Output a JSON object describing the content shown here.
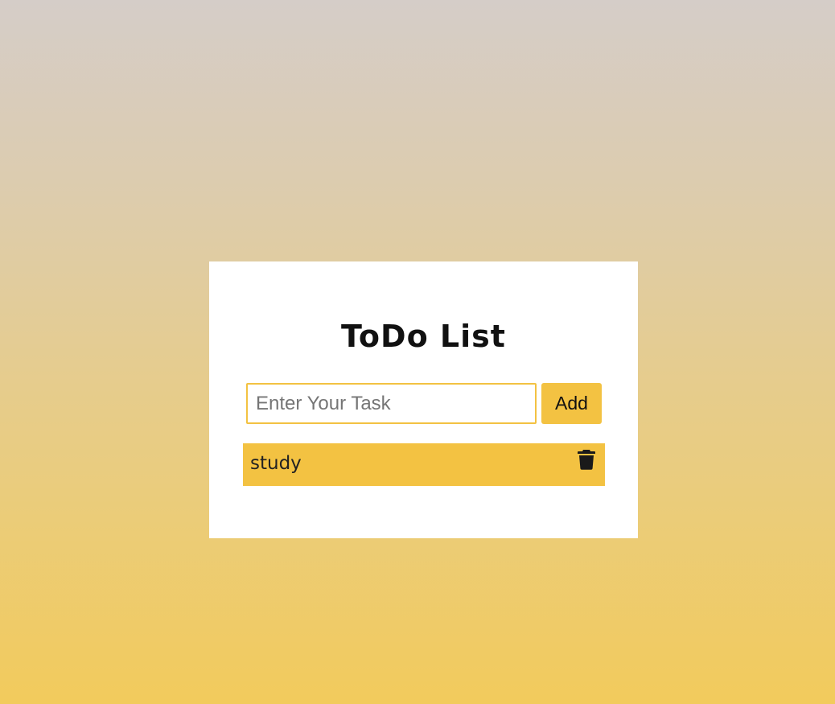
{
  "app": {
    "title": "ToDo List"
  },
  "input": {
    "placeholder": "Enter Your Task",
    "value": ""
  },
  "add_button": {
    "label": "Add"
  },
  "tasks": [
    {
      "label": "study",
      "delete_icon": "trash-icon"
    }
  ],
  "colors": {
    "accent": "#f3c242",
    "card": "#ffffff",
    "text": "#111111"
  }
}
